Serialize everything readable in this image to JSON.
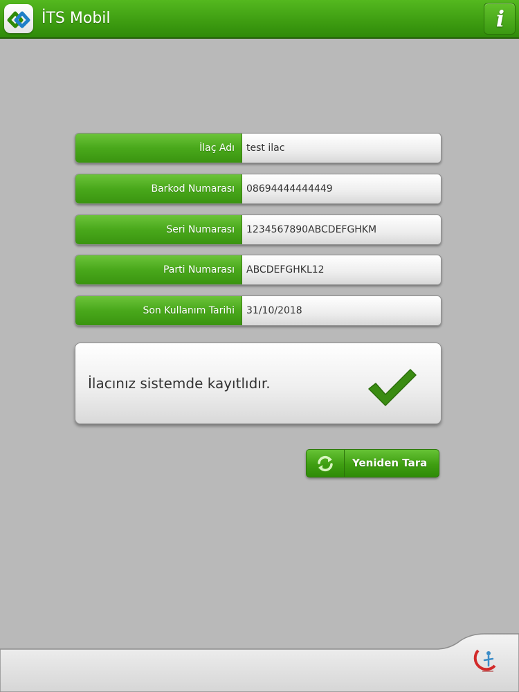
{
  "header": {
    "title": "İTS Mobil",
    "logo_icon": "its-logo-icon",
    "info_label": "i",
    "color": "#3f9e12"
  },
  "fields": [
    {
      "label": "İlaç Adı",
      "value": "test ilac"
    },
    {
      "label": "Barkod Numarası",
      "value": "08694444444449"
    },
    {
      "label": "Seri Numarası",
      "value": "1234567890ABCDEFGHKM"
    },
    {
      "label": "Parti Numarası",
      "value": "ABCDEFGHKL12"
    },
    {
      "label": "Son Kullanım Tarihi",
      "value": "31/10/2018"
    }
  ],
  "status": {
    "message": "İlacınız sistemde kayıtlıdır.",
    "icon": "checkmark-icon",
    "color": "#3a8c12"
  },
  "actions": {
    "rescan_label": "Yeniden Tara",
    "rescan_icon": "refresh-icon"
  },
  "footer": {
    "logo_icon": "ministry-of-health-logo"
  }
}
